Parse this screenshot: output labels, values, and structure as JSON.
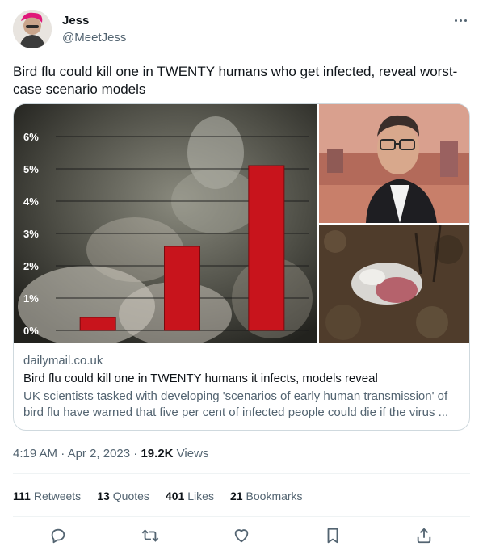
{
  "author": {
    "name": "Jess",
    "handle": "@MeetJess"
  },
  "tweet": {
    "text": "Bird flu could kill one in TWENTY humans who get infected, reveal worst-case scenario models"
  },
  "card": {
    "domain": "dailymail.co.uk",
    "title": "Bird flu could kill one in TWENTY humans it infects, models reveal",
    "description": "UK scientists tasked with developing 'scenarios of early human transmission' of bird flu have warned that five per cent of infected people could die if the virus ..."
  },
  "chart_data": {
    "type": "bar",
    "categories": [
      "",
      "",
      ""
    ],
    "values": [
      0.4,
      2.6,
      5.1
    ],
    "yticks": [
      "0%",
      "1%",
      "2%",
      "3%",
      "4%",
      "5%",
      "6%"
    ],
    "ylim": [
      0,
      6
    ],
    "bar_color": "#c8141c",
    "grid": true
  },
  "meta": {
    "time": "4:19 AM",
    "sep": " · ",
    "date": "Apr 2, 2023",
    "views_count": "19.2K",
    "views_label": "Views"
  },
  "stats": [
    {
      "count": "111",
      "label": "Retweets"
    },
    {
      "count": "13",
      "label": "Quotes"
    },
    {
      "count": "401",
      "label": "Likes"
    },
    {
      "count": "21",
      "label": "Bookmarks"
    }
  ],
  "actions": [
    {
      "name": "reply-icon"
    },
    {
      "name": "retweet-icon"
    },
    {
      "name": "like-icon"
    },
    {
      "name": "bookmark-icon"
    },
    {
      "name": "share-icon"
    }
  ],
  "colors": {
    "text": "#0f1419",
    "secondary": "#536471",
    "border": "#cfd9de",
    "icon": "#536471"
  }
}
